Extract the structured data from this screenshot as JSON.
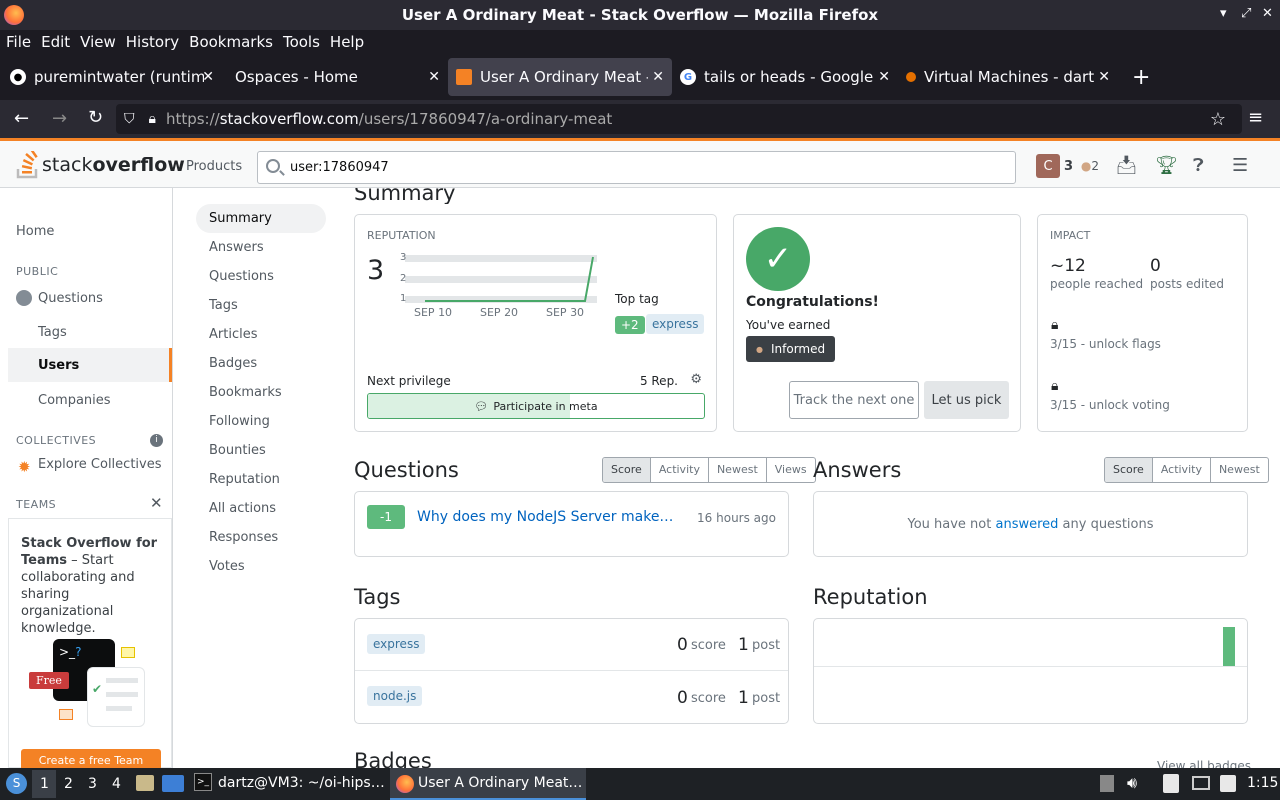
{
  "window": {
    "title": "User A Ordinary Meat - Stack Overflow — Mozilla Firefox"
  },
  "menu": [
    "File",
    "Edit",
    "View",
    "History",
    "Bookmarks",
    "Tools",
    "Help"
  ],
  "tabs": [
    {
      "label": "puremintwater (runtime)",
      "icon": "github-icon"
    },
    {
      "label": "Ospaces - Home",
      "icon": ""
    },
    {
      "label": "User A Ordinary Meat - Sta",
      "icon": "stackoverflow-icon"
    },
    {
      "label": "tails or heads - Google Se",
      "icon": "google-icon"
    },
    {
      "label": "Virtual Machines - dartz@",
      "icon": "proxmox-icon"
    }
  ],
  "url": {
    "scheme": "https://",
    "host": "stackoverflow.com",
    "path": "/users/17860947/a-ordinary-meat"
  },
  "so": {
    "logo_a": "stack",
    "logo_b": "overflow",
    "products": "Products",
    "search_value": "user:17860947",
    "avatar_letter": "C",
    "rep": "3",
    "bronze": "2"
  },
  "leftnav": {
    "home": "Home",
    "public": "PUBLIC",
    "questions": "Questions",
    "tags": "Tags",
    "users": "Users",
    "companies": "Companies",
    "collectives": "COLLECTIVES",
    "explore": "Explore Collectives",
    "teams": "TEAMS",
    "teams_title": "Stack Overflow for Teams",
    "teams_text": " – Start collaborating and sharing organizational knowledge.",
    "free": "Free",
    "cta": "Create a free Team"
  },
  "profnav": [
    "Summary",
    "Answers",
    "Questions",
    "Tags",
    "Articles",
    "Badges",
    "Bookmarks",
    "Following",
    "Bounties",
    "Reputation",
    "All actions",
    "Responses",
    "Votes"
  ],
  "summary": {
    "heading": "Summary",
    "reputation": {
      "label": "REPUTATION",
      "value": "3",
      "yticks": [
        "3",
        "2",
        "1"
      ],
      "xticks": [
        "SEP 10",
        "SEP 20",
        "SEP 30"
      ],
      "top_tag_label": "Top tag",
      "top_tag_score": "+2",
      "top_tag": "express",
      "next_privilege": "Next privilege",
      "next_rep": "5 Rep.",
      "privilege": "Participate in meta",
      "progress": 0.6
    },
    "badge": {
      "title": "Congratulations!",
      "earned": "You've earned",
      "badge": "Informed",
      "track": "Track the next one",
      "pick": "Let us pick"
    },
    "impact": {
      "label": "IMPACT",
      "reached_value": "~12",
      "reached_label": "people reached",
      "edited_value": "0",
      "edited_label": "posts edited",
      "flags": "3/15 - unlock flags",
      "voting": "3/15 - unlock voting"
    }
  },
  "questions": {
    "heading": "Questions",
    "filters": [
      "Score",
      "Activity",
      "Newest",
      "Views"
    ],
    "items": [
      {
        "score": "-1",
        "title": "Why does my NodeJS Server make…",
        "time": "16 hours ago"
      }
    ]
  },
  "answers": {
    "heading": "Answers",
    "filters": [
      "Score",
      "Activity",
      "Newest"
    ],
    "empty_a": "You have not ",
    "empty_link": "answered",
    "empty_b": " any questions"
  },
  "tags": {
    "heading": "Tags",
    "items": [
      {
        "name": "express",
        "score": "0",
        "score_label": "score",
        "posts": "1",
        "posts_label": "post"
      },
      {
        "name": "node.js",
        "score": "0",
        "score_label": "score",
        "posts": "1",
        "posts_label": "post"
      }
    ]
  },
  "reputation": {
    "heading": "Reputation"
  },
  "badges": {
    "heading": "Badges",
    "view_all": "View all badges"
  },
  "taskbar": {
    "workspaces": [
      "1",
      "2",
      "3",
      "4"
    ],
    "term": "dartz@VM3: ~/oi-hips…",
    "browser": "User A Ordinary Meat…",
    "time": "1:15"
  },
  "colors": {
    "accent": "#f48225",
    "link": "#0074cc",
    "green": "#5eba7d"
  }
}
